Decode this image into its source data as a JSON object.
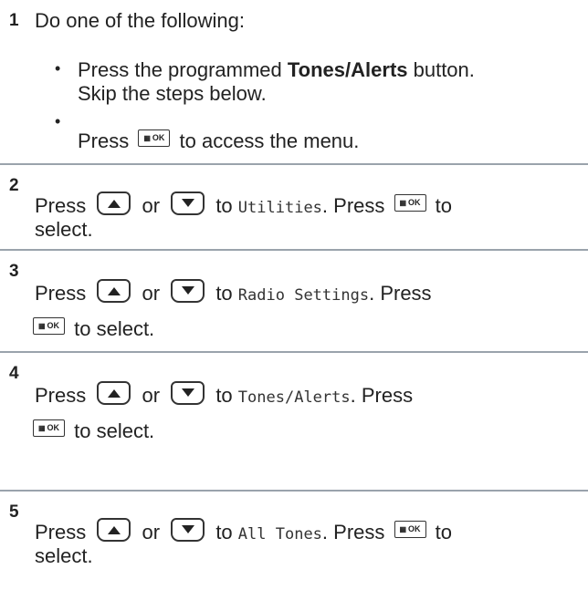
{
  "steps": [
    {
      "number": "1",
      "intro": "Do one of the following:",
      "options": [
        {
          "pre": "Press the programmed ",
          "bold": "Tones/Alerts",
          "post": " button.",
          "line2": "Skip the steps below."
        },
        {
          "pre": "Press",
          "post": "to access the menu."
        }
      ]
    },
    {
      "number": "2",
      "press": "Press",
      "or": "or",
      "to": "to",
      "menu_item": "Utilities",
      "after": ". Press",
      "to2": "to",
      "line2": "select."
    },
    {
      "number": "3",
      "press": "Press",
      "or": "or",
      "to": "to",
      "menu_item": "Radio Settings",
      "after": ". Press",
      "line2": "to select."
    },
    {
      "number": "4",
      "press": "Press",
      "or": "or",
      "to": "to",
      "menu_item": "Tones/Alerts",
      "after": ". Press",
      "line2": "to select."
    },
    {
      "number": "5",
      "press": "Press",
      "or": "or",
      "to": "to",
      "menu_item": "All Tones",
      "after": ". Press",
      "to2": "to",
      "line2": "select."
    }
  ],
  "buttons": {
    "ok_label": "OK",
    "ok_grid": "▦"
  },
  "icons": [
    "menu-ok-button-icon",
    "up-arrow-button-icon",
    "down-arrow-button-icon"
  ]
}
